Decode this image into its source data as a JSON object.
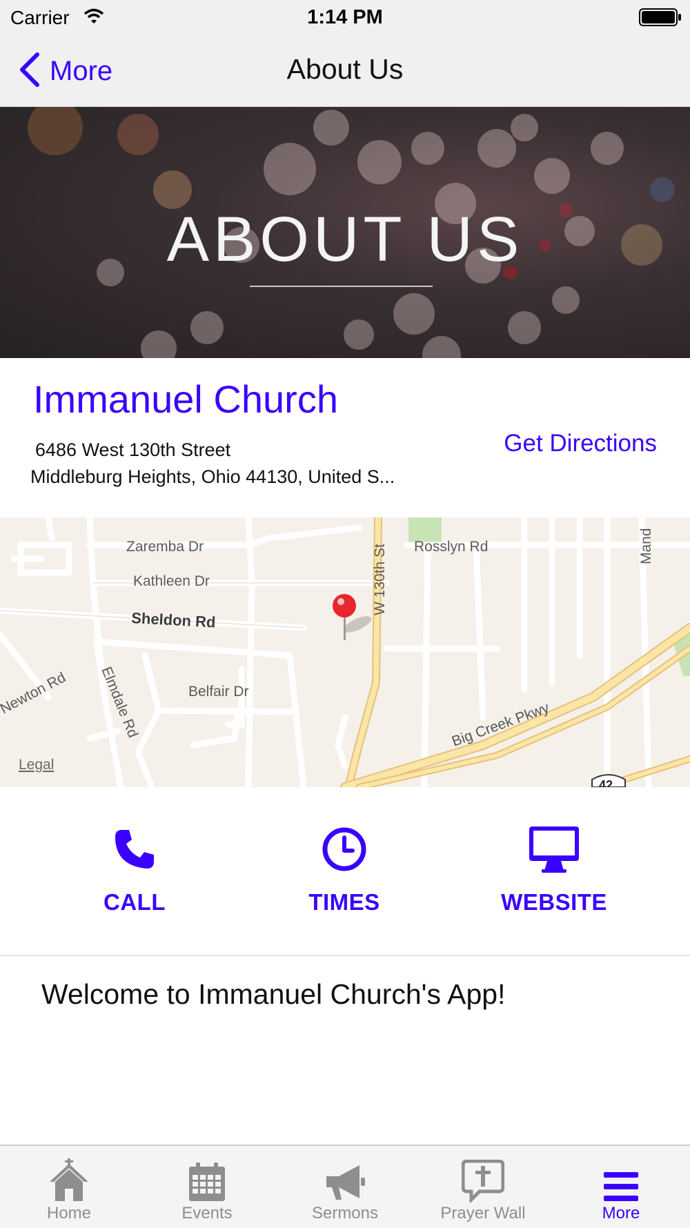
{
  "status_bar": {
    "carrier": "Carrier",
    "time": "1:14 PM"
  },
  "nav": {
    "back_label": "More",
    "title": "About Us"
  },
  "banner": {
    "title": "ABOUT US"
  },
  "church": {
    "name": "Immanuel Church",
    "address_line1": "6486 West 130th Street",
    "address_line2": "Middleburg Heights, Ohio 44130, United S...",
    "directions_label": "Get Directions"
  },
  "map": {
    "legal": "Legal",
    "streets": {
      "zaremba": "Zaremba Dr",
      "kathleen": "Kathleen Dr",
      "sheldon": "Sheldon Rd",
      "belfair": "Belfair Dr",
      "newton": "Newton Rd",
      "elmdale": "Elmdale Rd",
      "rosslyn": "Rosslyn Rd",
      "w130th": "W 130th St",
      "bigcreek": "Big Creek Pkwy",
      "manda": "Mand",
      "route": "42"
    }
  },
  "actions": [
    {
      "label": "CALL",
      "icon": "phone-icon"
    },
    {
      "label": "TIMES",
      "icon": "clock-icon"
    },
    {
      "label": "WEBSITE",
      "icon": "monitor-icon"
    }
  ],
  "welcome": "Welcome to Immanuel Church's App!",
  "tabs": [
    {
      "label": "Home",
      "icon": "home-icon",
      "active": false
    },
    {
      "label": "Events",
      "icon": "calendar-icon",
      "active": false
    },
    {
      "label": "Sermons",
      "icon": "megaphone-icon",
      "active": false
    },
    {
      "label": "Prayer Wall",
      "icon": "prayer-bubble-icon",
      "active": false
    },
    {
      "label": "More",
      "icon": "menu-icon",
      "active": true
    }
  ],
  "colors": {
    "accent": "#3a00ff",
    "inactive": "#8e8e8e",
    "pin": "#e8262d"
  }
}
